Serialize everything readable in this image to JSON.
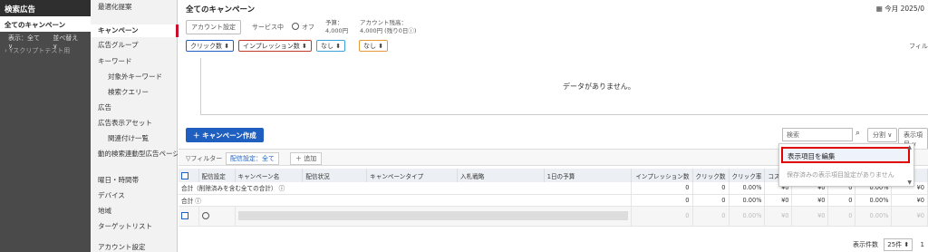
{
  "left_panel": {
    "header": "検索広告",
    "all_campaigns": "全てのキャンペーン",
    "display_filter": "表示：全て ∨",
    "sort": "並べ替え ∨",
    "account": "› Yスクリプトテスト用"
  },
  "nav": {
    "items": [
      {
        "label": "最適化提案"
      },
      {
        "label": "キャンペーン"
      },
      {
        "label": "広告グループ"
      },
      {
        "label": "キーワード"
      },
      {
        "label": "対象外キーワード"
      },
      {
        "label": "検索クエリー"
      },
      {
        "label": "広告"
      },
      {
        "label": "広告表示アセット"
      },
      {
        "label": "関連付け一覧"
      },
      {
        "label": "動的検索連動型広告ページ"
      },
      {
        "label": "曜日・時間帯"
      },
      {
        "label": "デバイス"
      },
      {
        "label": "地域"
      },
      {
        "label": "ターゲットリスト"
      },
      {
        "label": "アカウント設定"
      }
    ]
  },
  "header": {
    "title": "全てのキャンペーン",
    "date": "今月 2025/0",
    "account_settings": "アカウント設定",
    "service_label": "サービス中",
    "off_label": "オフ",
    "budget_label": "予算：",
    "budget_value": "4,000円",
    "balance_label": "アカウント残高：",
    "balance_value": "4,000円 (残り0日ⓘ)"
  },
  "metrics": [
    "クリック数 ⬍",
    "インプレッション数 ⬍",
    "なし ⬍",
    "なし ⬍"
  ],
  "right_cut": "フィル",
  "chart": {
    "no_data": "データがありません。"
  },
  "actions": {
    "create_campaign": "＋ キャンペーン作成",
    "search_placeholder": "検索",
    "split": "分割 ∨",
    "display_items": "表示項目 ∨",
    "filter": "▽フィルター",
    "delivery": "配信設定：全て",
    "add": "＋ 追加"
  },
  "table": {
    "headers": [
      "配信設定",
      "キャンペーン名",
      "配信状況",
      "キャンペーンタイプ",
      "入札戦略",
      "1日の予算",
      "インプレッション数",
      "クリック数",
      "クリック率",
      "コスト",
      "",
      "",
      "",
      ""
    ],
    "total_rows": [
      {
        "label": "合計（削除済みを含む全ての合計） ⓘ",
        "values": [
          "0",
          "0",
          "0.00%",
          "¥0",
          "¥0",
          "0",
          "0.00%",
          "¥0"
        ]
      },
      {
        "label": "合計 ⓘ",
        "values": [
          "0",
          "0",
          "0.00%",
          "¥0",
          "¥0",
          "0",
          "0.00%",
          "¥0"
        ]
      }
    ],
    "data_row": {
      "values": [
        "0",
        "0",
        "0.00%",
        "¥0",
        "¥0",
        "0",
        "0.00%",
        "¥0"
      ]
    }
  },
  "dropdown": {
    "edit_items": "表示項目を編集",
    "no_saved": "保存済みの表示項目設定がありません"
  },
  "footer": {
    "per_page_label": "表示件数",
    "per_page_value": "25件 ⬍",
    "page": "1"
  },
  "colors": {
    "accent_blue": "#1f5fbf",
    "active_red": "#c8102e",
    "highlight_red": "#e00000",
    "metric1": "#1f5fbf",
    "metric2": "#c0392b",
    "metric3": "#3aa3d9",
    "metric4": "#e69a3c"
  }
}
